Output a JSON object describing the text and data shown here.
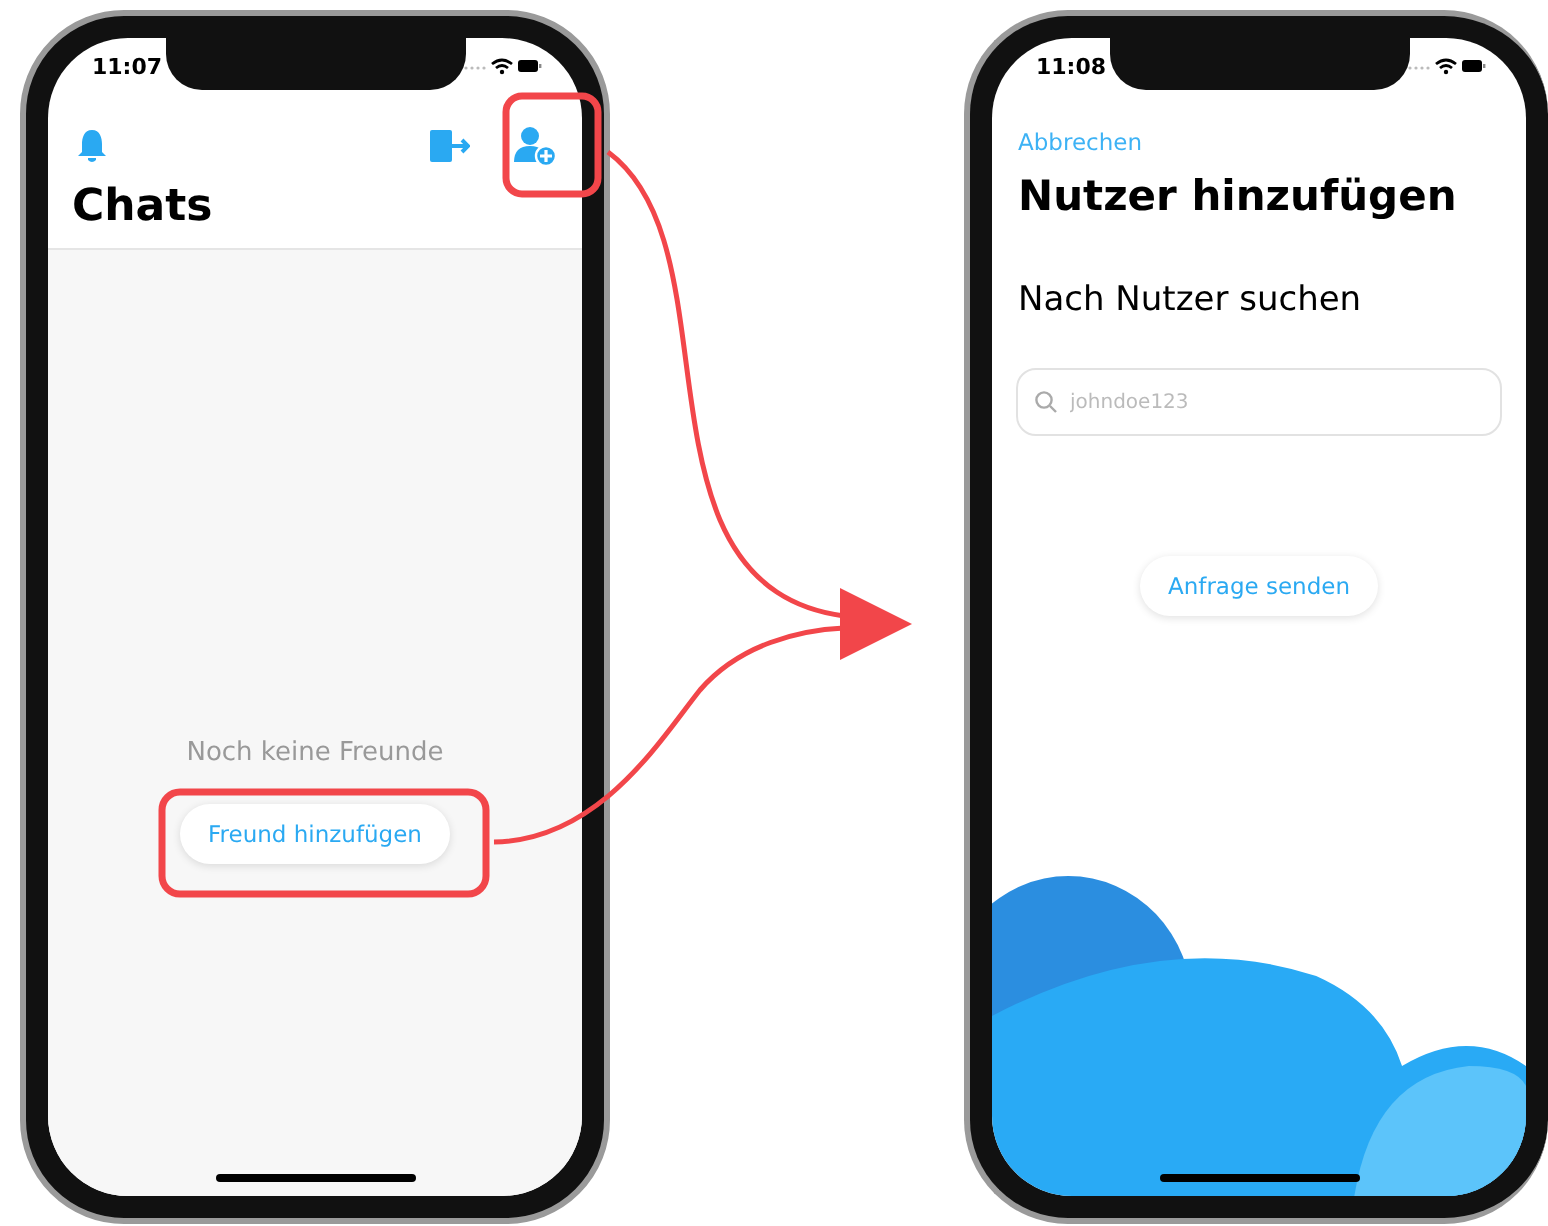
{
  "left_screen": {
    "status_time": "11:07",
    "title": "Chats",
    "empty_text": "Noch keine Freunde",
    "button": "Freund hinzufügen"
  },
  "right_screen": {
    "status_time": "11:08",
    "cancel": "Abbrechen",
    "title": "Nutzer hinzufügen",
    "subtitle": "Nach Nutzer suchen",
    "search": {
      "placeholder": "johndoe123"
    },
    "button": "Anfrage senden"
  }
}
